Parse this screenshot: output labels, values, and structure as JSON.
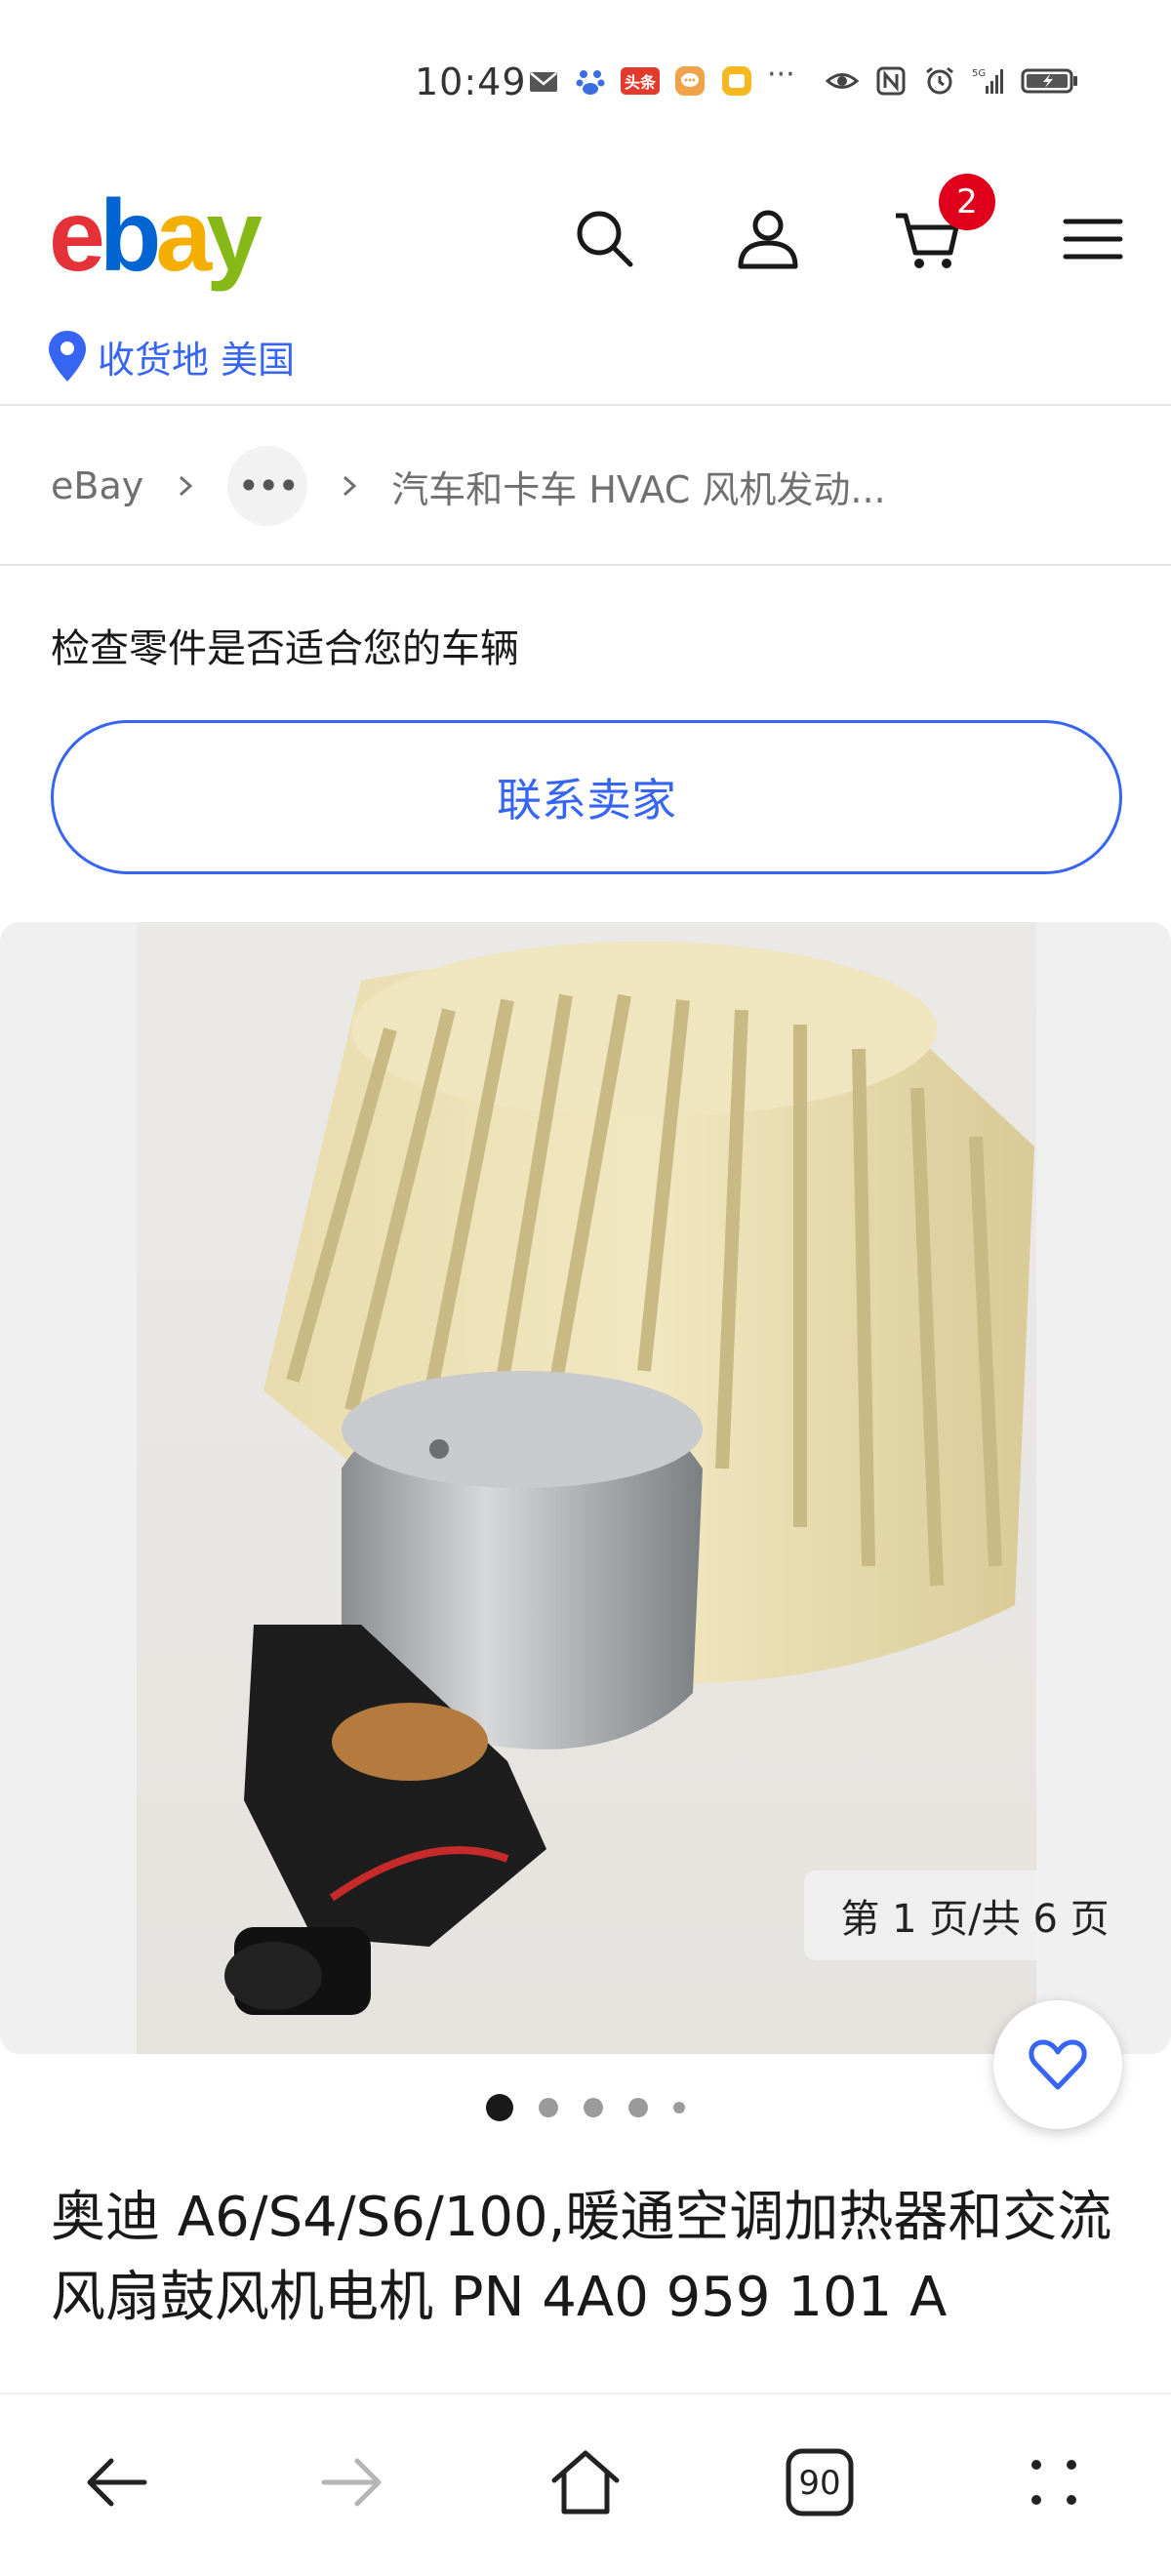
{
  "status_bar": {
    "time": "10:49",
    "badge_label": "头条",
    "more_dots": "···",
    "icons": [
      "mail-icon",
      "baidu-icon",
      "toutiao-icon",
      "chat-app-icon",
      "notification-app-icon",
      "eye-icon",
      "nfc-icon",
      "alarm-icon",
      "signal-5g-icon",
      "battery-charging-icon"
    ]
  },
  "header": {
    "logo_e": "e",
    "logo_b": "b",
    "logo_a": "a",
    "logo_y": "y",
    "cart_count": "2",
    "ship_to": "收货地 美国",
    "icons": [
      "search-icon",
      "account-icon",
      "cart-icon",
      "menu-icon",
      "location-pin-icon"
    ]
  },
  "breadcrumb": {
    "root": "eBay",
    "more": "•••",
    "current": "汽车和卡车 HVAC 风机发动..."
  },
  "compat": {
    "text": "检查零件是否适合您的车辆",
    "contact_button": "联系卖家"
  },
  "gallery": {
    "page_indicator": "第 1 页/共 6 页",
    "dot_count": 5,
    "active_index": 0
  },
  "listing": {
    "title": "奥迪 A6/S4/S6/100,暖通空调加热器和交流风扇鼓风机电机 PN 4A0 959 101 A"
  },
  "bottom_nav": {
    "tab_count": "90",
    "icons": [
      "back-arrow-icon",
      "forward-arrow-icon",
      "home-icon",
      "tabs-icon",
      "more-icon"
    ]
  },
  "colors": {
    "ebay_red": "#e53238",
    "ebay_blue": "#0064d2",
    "ebay_yellow": "#f5af02",
    "ebay_green": "#86b817",
    "link_blue": "#3665f3",
    "badge_red": "#e0001b"
  }
}
